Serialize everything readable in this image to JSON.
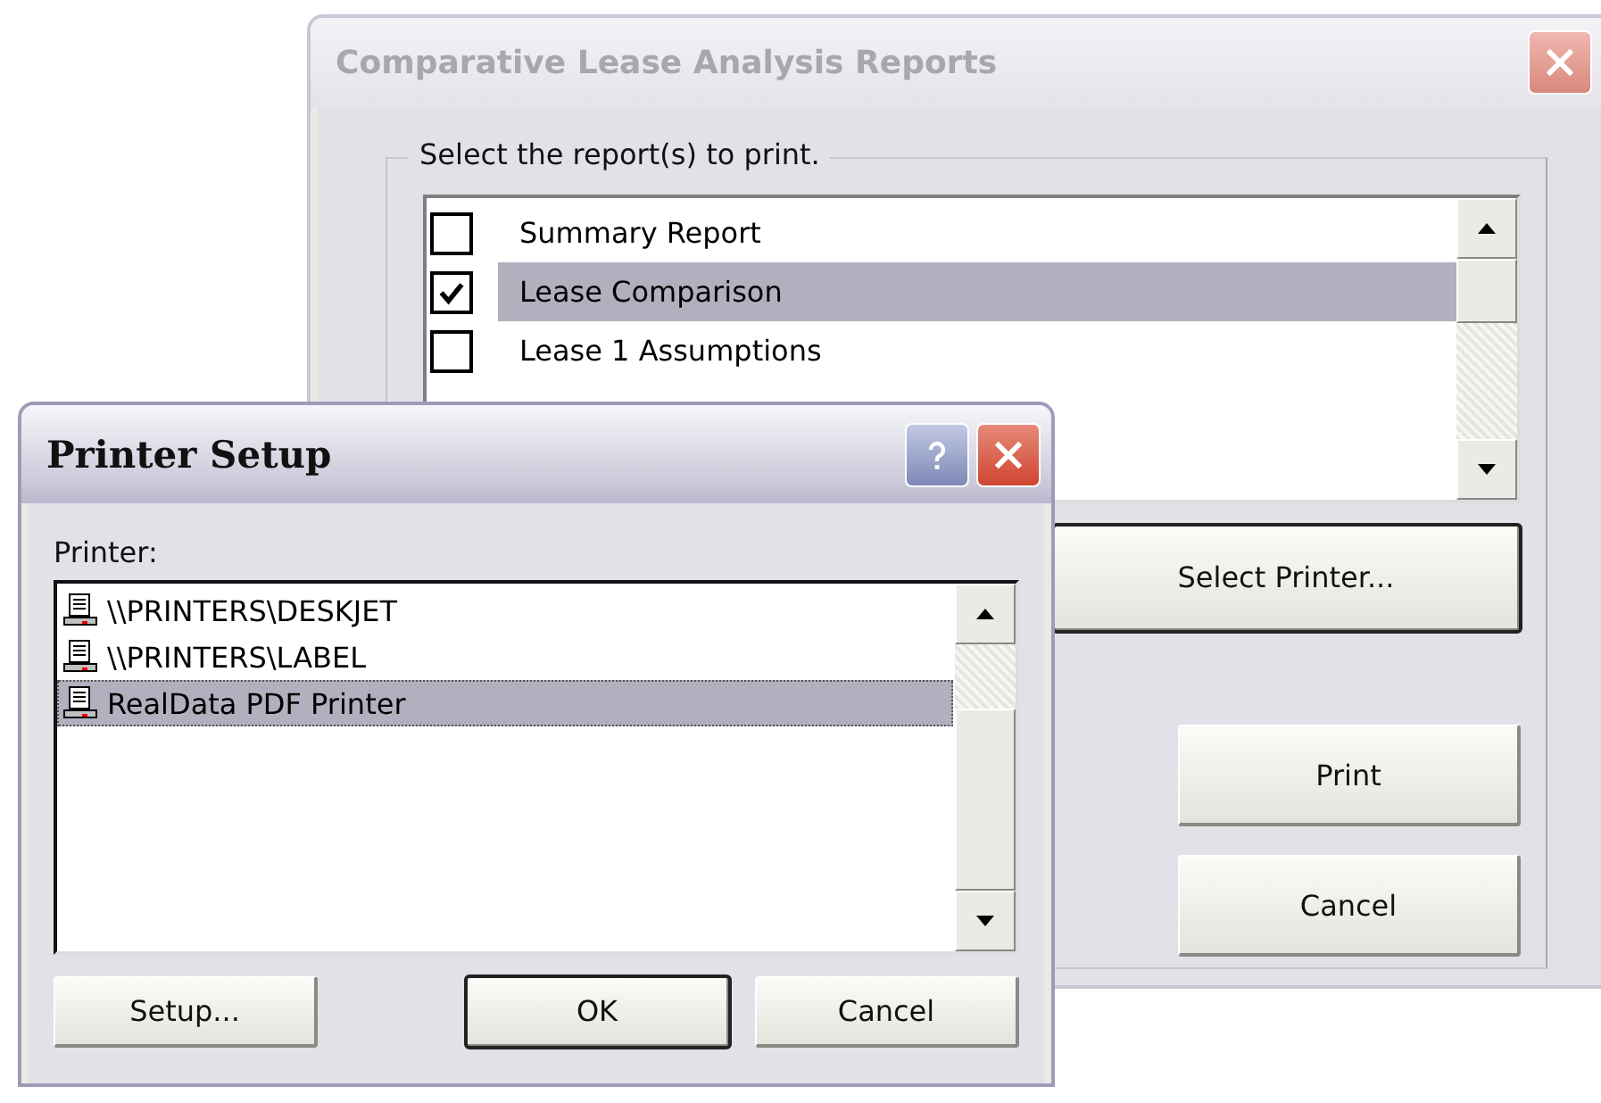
{
  "report_window": {
    "title": "Comparative Lease Analysis Reports",
    "active": false,
    "group_label": "Select the report(s) to print.",
    "reports": [
      {
        "label": "Summary Report",
        "checked": false,
        "selected": false
      },
      {
        "label": "Lease Comparison",
        "checked": true,
        "selected": true
      },
      {
        "label": "Lease 1 Assumptions",
        "checked": false,
        "selected": false
      }
    ],
    "buttons": [
      "Select Printer...",
      "Print",
      "Cancel"
    ]
  },
  "printer_window": {
    "title": "Printer Setup",
    "active": true,
    "printer_label": "Printer:",
    "printers": [
      {
        "name": "\\\\PRINTERS\\DESKJET",
        "selected": false
      },
      {
        "name": "\\\\PRINTERS\\LABEL",
        "selected": false
      },
      {
        "name": "RealData PDF Printer",
        "selected": true
      }
    ],
    "buttons": [
      "Setup...",
      "OK",
      "Cancel"
    ]
  }
}
